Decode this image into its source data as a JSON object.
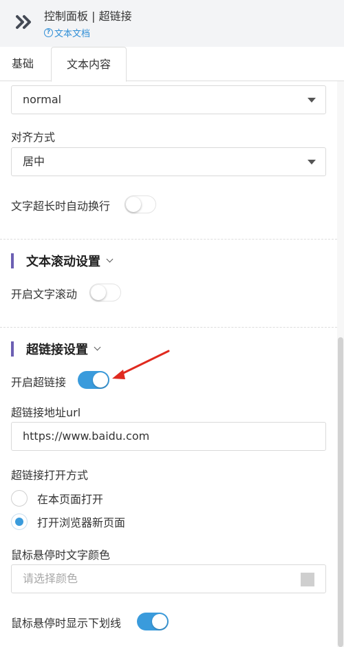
{
  "header": {
    "title": "控制面板 | 超链接",
    "doc_link": "文本文档",
    "expand_icon": "double-chevron-right-icon"
  },
  "tabs": [
    {
      "label": "基础",
      "active": false
    },
    {
      "label": "文本内容",
      "active": true
    }
  ],
  "font_weight_select": {
    "value": "normal"
  },
  "align": {
    "label": "对齐方式",
    "value": "居中"
  },
  "wrap": {
    "label": "文字超长时自动换行",
    "enabled": false
  },
  "scroll_section": {
    "title": "文本滚动设置",
    "enable_label": "开启文字滚动",
    "enabled": false
  },
  "link_section": {
    "title": "超链接设置",
    "enable_label": "开启超链接",
    "enabled": true,
    "url_label": "超链接地址url",
    "url_value": "https://www.baidu.com",
    "open_mode_label": "超链接打开方式",
    "open_options": [
      {
        "label": "在本页面打开",
        "checked": false
      },
      {
        "label": "打开浏览器新页面",
        "checked": true
      }
    ],
    "hover_color_label": "鼠标悬停时文字颜色",
    "hover_color_placeholder": "请选择颜色",
    "underline_label": "鼠标悬停时显示下划线",
    "underline_enabled": true
  },
  "colors": {
    "accent": "#3a9bdc",
    "section_bar": "#6c5fb3",
    "annotation_arrow": "#e02a1f"
  }
}
